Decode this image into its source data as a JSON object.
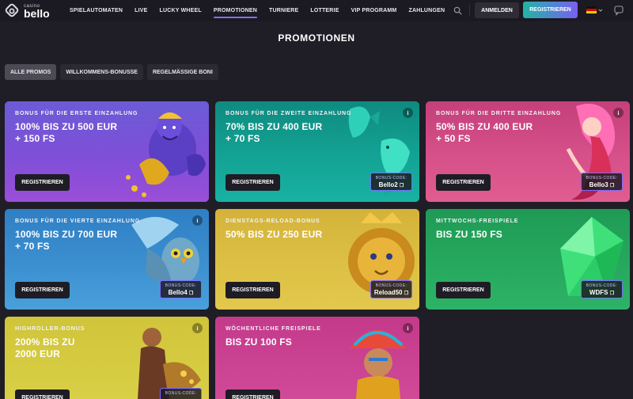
{
  "brand": {
    "small": "casino",
    "big": "bello"
  },
  "nav": [
    {
      "label": "SPIELAUTOMATEN",
      "active": false
    },
    {
      "label": "LIVE",
      "active": false
    },
    {
      "label": "LUCKY WHEEL",
      "active": false
    },
    {
      "label": "PROMOTIONEN",
      "active": true
    },
    {
      "label": "TURNIERE",
      "active": false
    },
    {
      "label": "LOTTERIE",
      "active": false
    },
    {
      "label": "VIP PROGRAMM",
      "active": false
    },
    {
      "label": "ZAHLUNGEN",
      "active": false
    }
  ],
  "header": {
    "login": "ANMELDEN",
    "register": "REGISTRIEREN"
  },
  "page": {
    "title": "PROMOTIONEN"
  },
  "filters": [
    {
      "label": "ALLE PROMOS",
      "active": true
    },
    {
      "label": "WILLKOMMENS-BONUSSE",
      "active": false
    },
    {
      "label": "REGELMÄSSIGE BONI",
      "active": false
    }
  ],
  "cards": [
    {
      "subtitle": "BONUS FÜR DIE ERSTE EINZAHLUNG",
      "line1": "100% BIS ZU 500 EUR",
      "line2": "+ 150 FS",
      "cta": "REGISTRIEREN",
      "code_label": "",
      "code": ""
    },
    {
      "subtitle": "BONUS FÜR DIE ZWEITE EINZAHLUNG",
      "line1": "70% BIS ZU 400 EUR",
      "line2": "+ 70 FS",
      "cta": "REGISTRIEREN",
      "code_label": "BONUS-CODE:",
      "code": "Bello2"
    },
    {
      "subtitle": "BONUS FÜR DIE DRITTE EINZAHLUNG",
      "line1": "50% BIS ZU 400 EUR",
      "line2": "+ 50 FS",
      "cta": "REGISTRIEREN",
      "code_label": "BONUS-CODE:",
      "code": "Bello3"
    },
    {
      "subtitle": "BONUS FÜR DIE VIERTE EINZAHLUNG",
      "line1": "100% BIS ZU 700 EUR",
      "line2": "+ 70 FS",
      "cta": "REGISTRIEREN",
      "code_label": "BONUS-CODE:",
      "code": "Bello4"
    },
    {
      "subtitle": "DIENSTAGS-RELOAD-BONUS",
      "line1": "50% BIS ZU 250 EUR",
      "line2": "",
      "cta": "REGISTRIEREN",
      "code_label": "BONUS-CODE:",
      "code": "Reload50"
    },
    {
      "subtitle": "MITTWOCHS-FREISPIELE",
      "line1": "BIS ZU 150 FS",
      "line2": "",
      "cta": "REGISTRIEREN",
      "code_label": "BONUS-CODE:",
      "code": "WDFS"
    },
    {
      "subtitle": "HIGHROLLER-BONUS",
      "line1": "200% BIS ZU",
      "line2": "2000 EUR",
      "cta": "REGISTRIEREN",
      "code_label": "BONUS-CODE:",
      "code": ""
    },
    {
      "subtitle": "WÖCHENTLICHE FREISPIELE",
      "line1": "BIS ZU 100 FS",
      "line2": "",
      "cta": "REGISTRIEREN",
      "code_label": "",
      "code": ""
    }
  ],
  "icons": {
    "search": "search-icon",
    "chat": "chat-icon",
    "info": "info-icon",
    "copy": "copy-icon",
    "flag": "german-flag-icon",
    "chevron": "chevron-down-icon"
  },
  "colors": {
    "accent": "#8a6cf0",
    "teal": "#21b5a6",
    "background": "#1f1e26"
  }
}
